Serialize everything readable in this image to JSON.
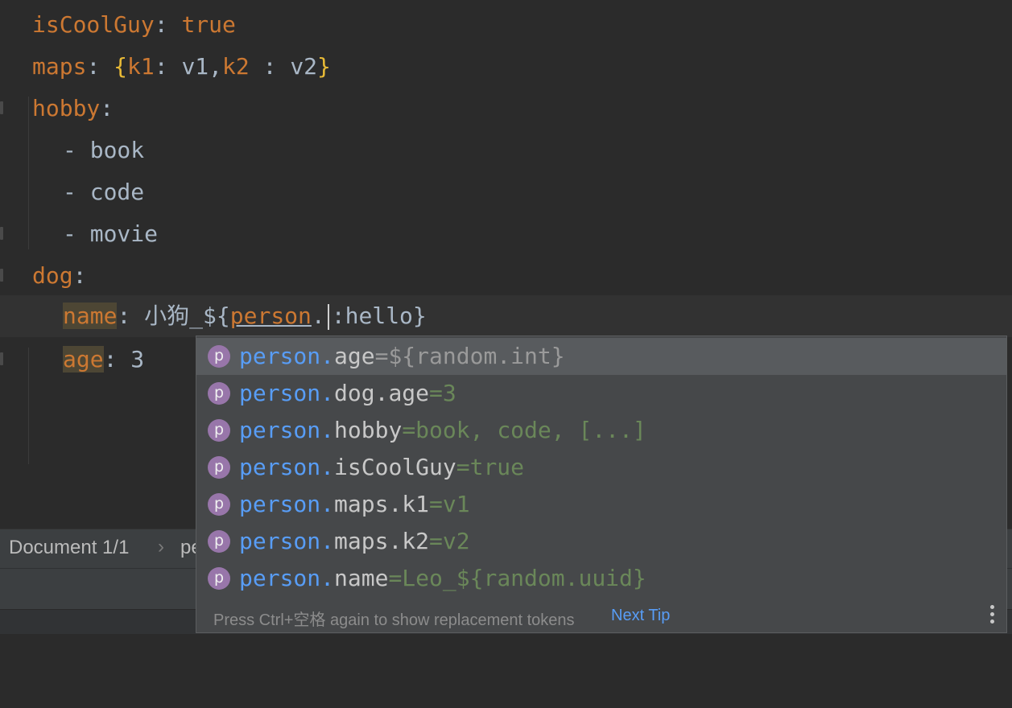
{
  "editor": {
    "lines": [
      {
        "key": "isCoolGuy",
        "sep": ": ",
        "value": "true"
      },
      {
        "key": "maps",
        "sep": ": ",
        "open": "{",
        "k1": "k1",
        "c1": ": ",
        "v1": "v1,",
        "k2": "k2",
        "c2": " : ",
        "v2": "v2",
        "close": "}"
      },
      {
        "key": "hobby",
        "sep": ":"
      },
      {
        "dash": "- ",
        "value": "book"
      },
      {
        "dash": "- ",
        "value": "code"
      },
      {
        "dash": "- ",
        "value": "movie"
      },
      {
        "key": "dog",
        "sep": ":"
      },
      {
        "key": "name",
        "sep": ": ",
        "cjk": "小狗",
        "rest": "_${",
        "ref": "person",
        "dot": ".",
        "after": ":hello}"
      },
      {
        "key": "age",
        "sep": ": ",
        "value": "3"
      }
    ]
  },
  "statusbar": {
    "document": "Document 1/1",
    "chevron": "›",
    "crumb": "pe"
  },
  "completion": {
    "items": [
      {
        "prefix": "person.",
        "name": "age",
        "value": "=${random.int}"
      },
      {
        "prefix": "person.",
        "name": "dog.age",
        "value": "=3"
      },
      {
        "prefix": "person.",
        "name": "hobby",
        "value": "=book, code, [...]"
      },
      {
        "prefix": "person.",
        "name": "isCoolGuy",
        "value": "=true"
      },
      {
        "prefix": "person.",
        "name": "maps.k1",
        "value": "=v1"
      },
      {
        "prefix": "person.",
        "name": "maps.k2",
        "value": "=v2"
      },
      {
        "prefix": "person.",
        "name": "name",
        "value": "=Leo_${random.uuid}"
      }
    ],
    "icon_letter": "p",
    "icon_name": "property-icon",
    "hint": "Press Ctrl+空格  again to show replacement tokens",
    "next_tip": "Next Tip",
    "more_icon": "vertical-ellipsis-icon"
  },
  "colors": {
    "background": "#2b2b2b",
    "key": "#cc7832",
    "brace": "#e8ba36",
    "prefix": "#589df6",
    "value": "#6a8759",
    "property_icon": "#9876aa"
  }
}
